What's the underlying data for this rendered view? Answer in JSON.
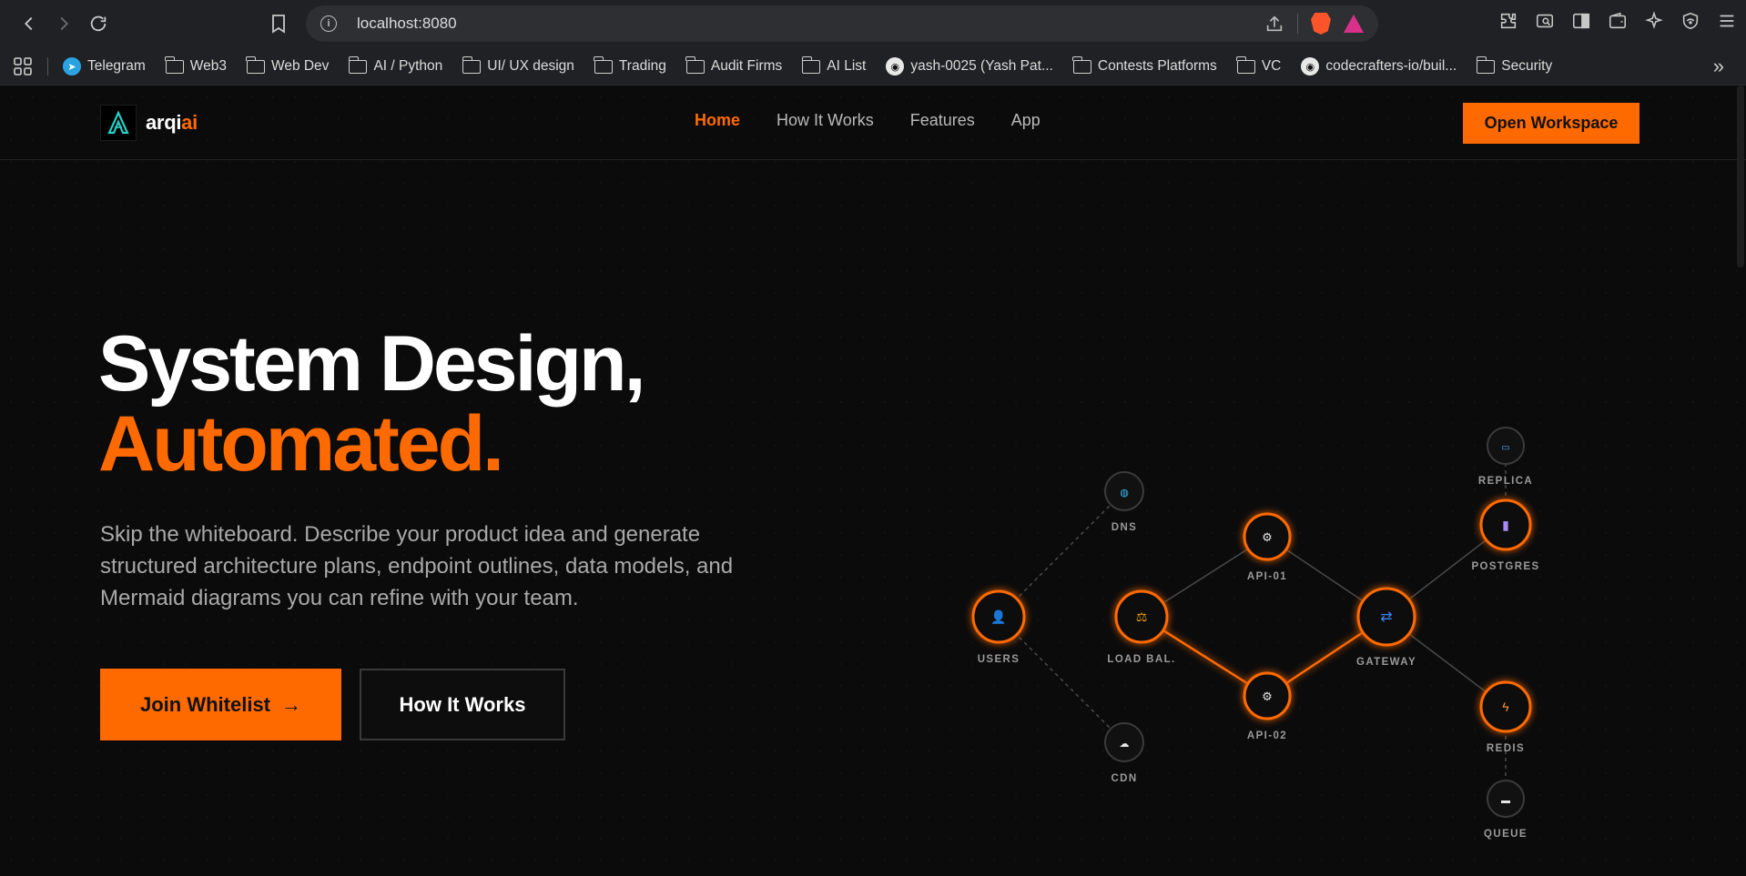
{
  "browser": {
    "url": "localhost:8080",
    "bookmarks": [
      {
        "label": "Telegram",
        "icon": "telegram-icon"
      },
      {
        "label": "Web3",
        "icon": "folder-icon"
      },
      {
        "label": "Web Dev",
        "icon": "folder-icon"
      },
      {
        "label": "AI / Python",
        "icon": "folder-icon"
      },
      {
        "label": "UI/ UX design",
        "icon": "folder-icon"
      },
      {
        "label": "Trading",
        "icon": "folder-icon"
      },
      {
        "label": "Audit Firms",
        "icon": "folder-icon"
      },
      {
        "label": "AI List",
        "icon": "folder-icon"
      },
      {
        "label": "yash-0025 (Yash Pat...",
        "icon": "github-icon"
      },
      {
        "label": "Contests Platforms",
        "icon": "folder-icon"
      },
      {
        "label": "VC",
        "icon": "folder-icon"
      },
      {
        "label": "codecrafters-io/buil...",
        "icon": "github-icon"
      },
      {
        "label": "Security",
        "icon": "folder-icon"
      }
    ],
    "more_label": "»"
  },
  "site": {
    "logo": {
      "main": "arqi",
      "accent": "ai"
    },
    "nav": [
      {
        "label": "Home",
        "active": true
      },
      {
        "label": "How It Works",
        "active": false
      },
      {
        "label": "Features",
        "active": false
      },
      {
        "label": "App",
        "active": false
      }
    ],
    "cta": "Open Workspace"
  },
  "hero": {
    "title_line1": "System Design,",
    "title_line2": "Automated.",
    "subtitle": "Skip the whiteboard. Describe your product idea and generate structured architecture plans, endpoint outlines, data models, and Mermaid diagrams you can refine with your team.",
    "primary_button": "Join Whitelist",
    "primary_arrow": "→",
    "secondary_button": "How It Works"
  },
  "diagram": {
    "nodes": [
      {
        "id": "users",
        "label": "USERS",
        "icon": "user-icon",
        "active": true
      },
      {
        "id": "dns",
        "label": "DNS",
        "icon": "globe-icon",
        "active": false
      },
      {
        "id": "cdn",
        "label": "CDN",
        "icon": "cloud-icon",
        "active": false
      },
      {
        "id": "lb",
        "label": "LOAD BAL.",
        "icon": "balance-icon",
        "active": true
      },
      {
        "id": "api1",
        "label": "API-01",
        "icon": "gear-icon",
        "active": true
      },
      {
        "id": "api2",
        "label": "API-02",
        "icon": "gear-icon",
        "active": true
      },
      {
        "id": "gateway",
        "label": "GATEWAY",
        "icon": "shuffle-icon",
        "active": true
      },
      {
        "id": "replica",
        "label": "REPLICA",
        "icon": "database-icon",
        "active": false
      },
      {
        "id": "postgres",
        "label": "POSTGRES",
        "icon": "storage-icon",
        "active": true
      },
      {
        "id": "redis",
        "label": "REDIS",
        "icon": "lightning-icon",
        "active": true
      },
      {
        "id": "queue",
        "label": "QUEUE",
        "icon": "inbox-icon",
        "active": false
      }
    ],
    "edges": [
      {
        "from": "users",
        "to": "lb",
        "style": "highlight"
      },
      {
        "from": "users",
        "to": "dns",
        "style": "dashed"
      },
      {
        "from": "users",
        "to": "cdn",
        "style": "dashed"
      },
      {
        "from": "lb",
        "to": "api1",
        "style": "solid"
      },
      {
        "from": "lb",
        "to": "api2",
        "style": "highlight"
      },
      {
        "from": "api1",
        "to": "gateway",
        "style": "solid"
      },
      {
        "from": "api2",
        "to": "gateway",
        "style": "highlight"
      },
      {
        "from": "gateway",
        "to": "postgres",
        "style": "solid"
      },
      {
        "from": "gateway",
        "to": "redis",
        "style": "solid"
      },
      {
        "from": "postgres",
        "to": "replica",
        "style": "dashed"
      },
      {
        "from": "redis",
        "to": "queue",
        "style": "dashed"
      }
    ]
  },
  "colors": {
    "accent": "#ff6a00",
    "background": "#0b0b0b"
  }
}
